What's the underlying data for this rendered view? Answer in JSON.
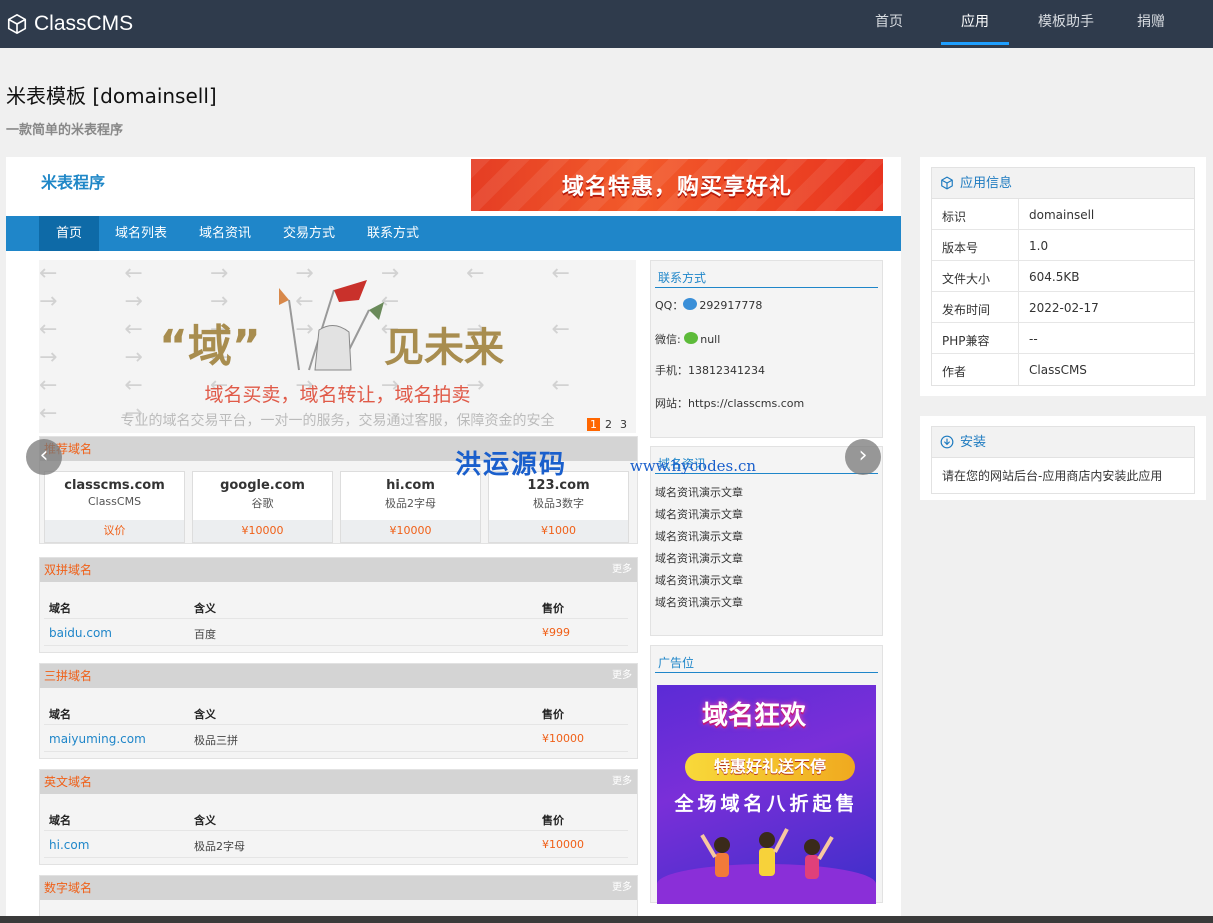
{
  "app": {
    "brand": "ClassCMS",
    "nav": [
      "首页",
      "应用",
      "模板助手",
      "捐赠"
    ],
    "active_nav": 1
  },
  "page": {
    "title": "米表模板 [domainsell]",
    "subtitle": "一款简单的米表程序"
  },
  "preview": {
    "logo": "米表程序",
    "banner": "域名特惠，购买享好礼",
    "nav": [
      "首页",
      "域名列表",
      "域名资讯",
      "交易方式",
      "联系方式"
    ],
    "slide": {
      "headline_left": "“域”",
      "headline_right": "见未来",
      "tagline": "域名买卖，域名转让，域名拍卖",
      "desc": "专业的域名交易平台，一对一的服务，交易通过客服，保障资金的安全",
      "pages": [
        "1",
        "2",
        "3"
      ]
    },
    "prev_icon": "‹",
    "next_icon": "›",
    "recommended": {
      "title": "推荐域名",
      "items": [
        {
          "name": "classcms.com",
          "desc": "ClassCMS",
          "price": "议价"
        },
        {
          "name": "google.com",
          "desc": "谷歌",
          "price": "¥10000"
        },
        {
          "name": "hi.com",
          "desc": "极品2字母",
          "price": "¥10000"
        },
        {
          "name": "123.com",
          "desc": "极品3数字",
          "price": "¥1000"
        }
      ]
    },
    "more": "更多",
    "columns": [
      "域名",
      "含义",
      "售价"
    ],
    "sections": [
      {
        "title": "双拼域名",
        "row": {
          "domain": "baidu.com",
          "meaning": "百度",
          "price": "¥999"
        }
      },
      {
        "title": "三拼域名",
        "row": {
          "domain": "maiyuming.com",
          "meaning": "极品三拼",
          "price": "¥10000"
        }
      },
      {
        "title": "英文域名",
        "row": {
          "domain": "hi.com",
          "meaning": "极品2字母",
          "price": "¥10000"
        }
      },
      {
        "title": "数字域名"
      }
    ],
    "contact": {
      "title": "联系方式",
      "qq_label": "QQ：",
      "qq": "292917778",
      "wechat_label": "微信:",
      "wechat": "null",
      "phone": "手机：13812341234",
      "site": "网站：https://classcms.com"
    },
    "news": {
      "title": "域名资讯",
      "items": [
        "域名资讯演示文章",
        "域名资讯演示文章",
        "域名资讯演示文章",
        "域名资讯演示文章",
        "域名资讯演示文章",
        "域名资讯演示文章"
      ]
    },
    "ad": {
      "title": "广告位",
      "line1": "域名狂欢",
      "line2": "特惠好礼送不停",
      "line3": "全场域名八折起售"
    },
    "watermark": "洪运源码",
    "watermark_url": "www.hycodes.cn"
  },
  "app_info": {
    "title": "应用信息",
    "rows": [
      {
        "k": "标识",
        "v": "domainsell"
      },
      {
        "k": "版本号",
        "v": "1.0"
      },
      {
        "k": "文件大小",
        "v": "604.5KB"
      },
      {
        "k": "发布时间",
        "v": "2022-02-17"
      },
      {
        "k": "PHP兼容",
        "v": "--"
      },
      {
        "k": "作者",
        "v": "ClassCMS"
      }
    ]
  },
  "install": {
    "title": "安装",
    "text": "请在您的网站后台-应用商店内安装此应用"
  },
  "colors": {
    "topbar": "#2f3b4c",
    "accent": "#1e9fff",
    "preview_nav": "#1f86c9",
    "price": "#f06018"
  }
}
